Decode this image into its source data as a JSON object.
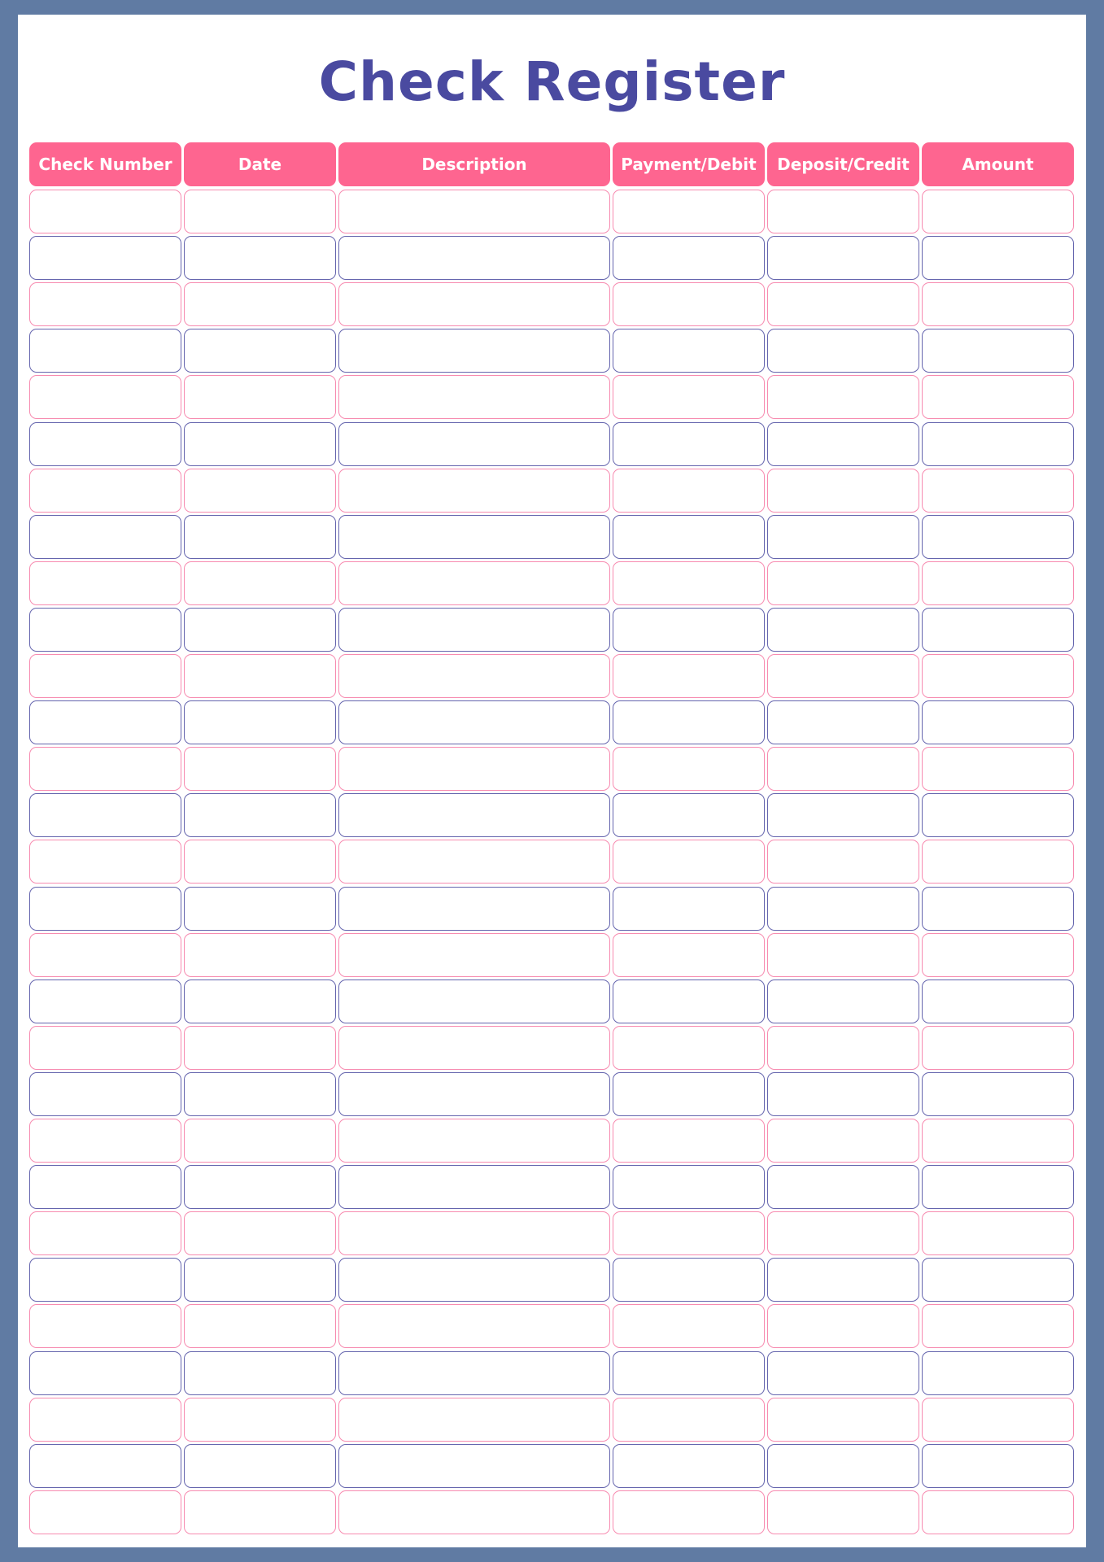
{
  "title": "Check Register",
  "colors": {
    "frame": "#607ba3",
    "title": "#4a4aa0",
    "header_bg": "#fe6590",
    "header_text": "#ffffff",
    "row_border_odd": "#f78bb0",
    "row_border_even": "#6565ae"
  },
  "table": {
    "columns": [
      "Check Number",
      "Date",
      "Description",
      "Payment/Debit",
      "Deposit/Credit",
      "Amount"
    ],
    "row_count": 29,
    "rows": [
      [
        "",
        "",
        "",
        "",
        "",
        ""
      ],
      [
        "",
        "",
        "",
        "",
        "",
        ""
      ],
      [
        "",
        "",
        "",
        "",
        "",
        ""
      ],
      [
        "",
        "",
        "",
        "",
        "",
        ""
      ],
      [
        "",
        "",
        "",
        "",
        "",
        ""
      ],
      [
        "",
        "",
        "",
        "",
        "",
        ""
      ],
      [
        "",
        "",
        "",
        "",
        "",
        ""
      ],
      [
        "",
        "",
        "",
        "",
        "",
        ""
      ],
      [
        "",
        "",
        "",
        "",
        "",
        ""
      ],
      [
        "",
        "",
        "",
        "",
        "",
        ""
      ],
      [
        "",
        "",
        "",
        "",
        "",
        ""
      ],
      [
        "",
        "",
        "",
        "",
        "",
        ""
      ],
      [
        "",
        "",
        "",
        "",
        "",
        ""
      ],
      [
        "",
        "",
        "",
        "",
        "",
        ""
      ],
      [
        "",
        "",
        "",
        "",
        "",
        ""
      ],
      [
        "",
        "",
        "",
        "",
        "",
        ""
      ],
      [
        "",
        "",
        "",
        "",
        "",
        ""
      ],
      [
        "",
        "",
        "",
        "",
        "",
        ""
      ],
      [
        "",
        "",
        "",
        "",
        "",
        ""
      ],
      [
        "",
        "",
        "",
        "",
        "",
        ""
      ],
      [
        "",
        "",
        "",
        "",
        "",
        ""
      ],
      [
        "",
        "",
        "",
        "",
        "",
        ""
      ],
      [
        "",
        "",
        "",
        "",
        "",
        ""
      ],
      [
        "",
        "",
        "",
        "",
        "",
        ""
      ],
      [
        "",
        "",
        "",
        "",
        "",
        ""
      ],
      [
        "",
        "",
        "",
        "",
        "",
        ""
      ],
      [
        "",
        "",
        "",
        "",
        "",
        ""
      ],
      [
        "",
        "",
        "",
        "",
        "",
        ""
      ],
      [
        "",
        "",
        "",
        "",
        "",
        ""
      ]
    ]
  }
}
